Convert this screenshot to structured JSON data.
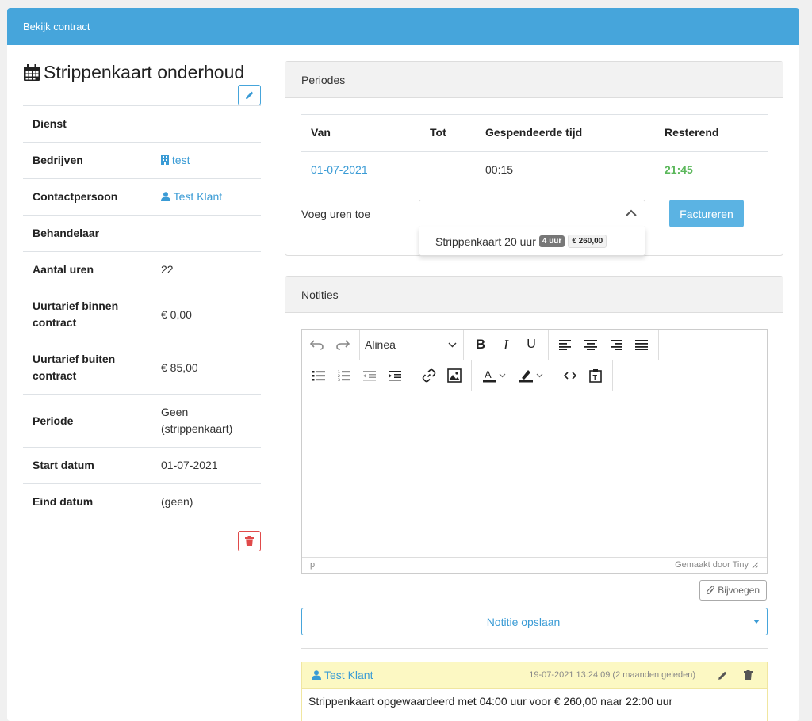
{
  "header": {
    "title": "Bekijk contract"
  },
  "contract": {
    "title": "Strippenkaart onderhoud",
    "rows": [
      {
        "key": "Dienst",
        "value": ""
      },
      {
        "key": "Bedrijven",
        "value": "test"
      },
      {
        "key": "Contactpersoon",
        "value": "Test Klant"
      },
      {
        "key": "Behandelaar",
        "value": ""
      },
      {
        "key": "Aantal uren",
        "value": "22"
      },
      {
        "key": "Uurtarief binnen contract",
        "value": "€ 0,00"
      },
      {
        "key": "Uurtarief buiten contract",
        "value": "€ 85,00"
      },
      {
        "key": "Periode",
        "value": "Geen (strippenkaart)"
      },
      {
        "key": "Start datum",
        "value": "01-07-2021"
      },
      {
        "key": "Eind datum",
        "value": "(geen)"
      }
    ]
  },
  "periodes": {
    "title": "Periodes",
    "columns": [
      "Van",
      "Tot",
      "Gespendeerde tijd",
      "Resterend"
    ],
    "rows": [
      {
        "van": "01-07-2021",
        "tot": "",
        "gespendeerd": "00:15",
        "resterend": "21:45"
      }
    ],
    "add_label": "Voeg uren toe",
    "dropdown_option": {
      "label": "Strippenkaart 20 uur",
      "hours_badge": "4 uur",
      "price_badge": "€ 260,00"
    },
    "invoice_button": "Factureren"
  },
  "notities": {
    "title": "Notities",
    "editor": {
      "format_select": "Alinea",
      "status_path": "p",
      "branding": "Gemaakt door Tiny"
    },
    "attach_button": "Bijvoegen",
    "save_button": "Notitie opslaan",
    "note": {
      "author": "Test Klant",
      "date": "19-07-2021 13:24:09 (2 maanden geleden)",
      "text": "Strippenkaart opgewaardeerd met 04:00 uur voor € 260,00 naar 22:00 uur"
    }
  },
  "colors": {
    "header": "#46a5db",
    "link": "#3a9bd5",
    "success": "#5cb85c",
    "danger": "#e04a4a"
  }
}
